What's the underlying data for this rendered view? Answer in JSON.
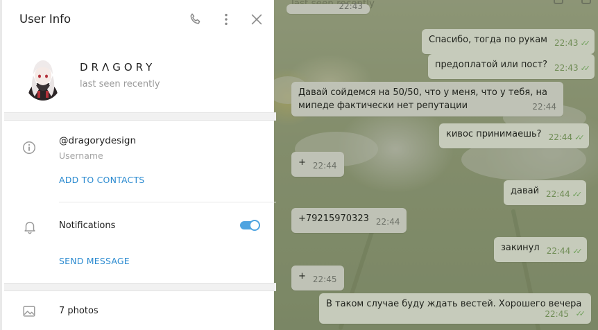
{
  "panel": {
    "title": "User Info",
    "profile": {
      "name": "DRΛGORY",
      "status": "last seen recently"
    },
    "info": {
      "username": "@dragorydesign",
      "username_label": "Username",
      "add_contact": "ADD TO CONTACTS"
    },
    "notifications": {
      "label": "Notifications",
      "enabled": true
    },
    "send_message": "SEND MESSAGE",
    "media": {
      "photos": "7 photos"
    }
  },
  "chat": {
    "header_status": "last seen recently",
    "messages": [
      {
        "text": "Спасибо, тогда по рукам",
        "time": "22:43",
        "dir": "out"
      },
      {
        "text": "предоплатой или пост?",
        "time": "22:43",
        "dir": "out"
      },
      {
        "text": "Давай сойдемся на 50/50, что у меня, что у тебя, на мипеде фактически нет репутации",
        "time": "22:44",
        "dir": "in"
      },
      {
        "text": "кивос принимаешь?",
        "time": "22:44",
        "dir": "out"
      },
      {
        "text": "+",
        "time": "22:44",
        "dir": "in"
      },
      {
        "text": "давай",
        "time": "22:44",
        "dir": "out"
      },
      {
        "text": "+79215970323",
        "time": "22:44",
        "dir": "in"
      },
      {
        "text": "закинул",
        "time": "22:44",
        "dir": "out"
      },
      {
        "text": "+",
        "time": "22:45",
        "dir": "in"
      },
      {
        "text": "В таком случае буду ждать вестей. Хорошего вечера",
        "time": "22:45",
        "dir": "out"
      }
    ]
  },
  "colors": {
    "accent": "#2c8bd0",
    "toggle": "#4fa4e0"
  },
  "icons": [
    "phone-icon",
    "more-vertical-icon",
    "close-icon",
    "info-icon",
    "bell-icon",
    "image-icon"
  ]
}
